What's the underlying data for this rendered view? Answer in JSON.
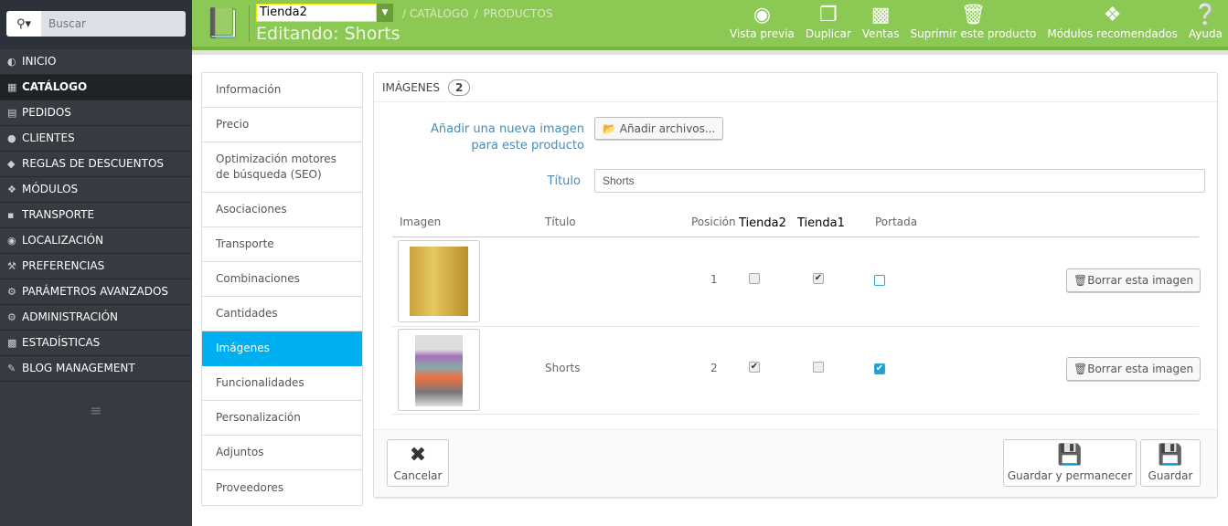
{
  "search": {
    "placeholder": "Buscar",
    "icon": "search-icon"
  },
  "sidebar": {
    "items": [
      {
        "label": "INICIO",
        "icon": "dashboard-icon"
      },
      {
        "label": "CATÁLOGO",
        "icon": "book-icon",
        "active": true
      },
      {
        "label": "PEDIDOS",
        "icon": "credit-card-icon"
      },
      {
        "label": "CLIENTES",
        "icon": "users-icon"
      },
      {
        "label": "REGLAS DE DESCUENTOS",
        "icon": "tags-icon"
      },
      {
        "label": "MÓDULOS",
        "icon": "puzzle-icon"
      },
      {
        "label": "TRANSPORTE",
        "icon": "truck-icon"
      },
      {
        "label": "LOCALIZACIÓN",
        "icon": "globe-icon"
      },
      {
        "label": "PREFERENCIAS",
        "icon": "wrench-icon"
      },
      {
        "label": "PARÁMETROS AVANZADOS",
        "icon": "cogs-icon"
      },
      {
        "label": "ADMINISTRACIÓN",
        "icon": "cog-icon"
      },
      {
        "label": "ESTADÍSTICAS",
        "icon": "bar-chart-icon"
      },
      {
        "label": "BLOG MANAGEMENT",
        "icon": "pencil-icon"
      }
    ]
  },
  "header": {
    "shop": "Tienda2",
    "breadcrumb": [
      "CATÁLOGO",
      "PRODUCTOS"
    ],
    "title": "Editando: Shorts",
    "color": "#8bc954",
    "tools": [
      {
        "label": "Vista previa",
        "icon": "eye-icon"
      },
      {
        "label": "Duplicar",
        "icon": "copy-icon"
      },
      {
        "label": "Ventas",
        "icon": "bar-chart-icon"
      },
      {
        "label": "Suprimir este producto",
        "icon": "trash-icon"
      },
      {
        "label": "Módulos recomendados",
        "icon": "puzzle-icon"
      },
      {
        "label": "Ayuda",
        "icon": "help-icon"
      }
    ]
  },
  "tabs": [
    "Información",
    "Precio",
    "Optimización motores de búsqueda (SEO)",
    "Asociaciones",
    "Transporte",
    "Combinaciones",
    "Cantidades",
    "Imágenes",
    "Funcionalidades",
    "Personalización",
    "Adjuntos",
    "Proveedores"
  ],
  "panel": {
    "title": "IMÁGENES",
    "count": "2",
    "add_label": "Añadir una nueva imagen para este producto",
    "add_button": "Añadir archivos...",
    "title_label": "Título",
    "title_value": "Shorts",
    "columns": [
      "Imagen",
      "Título",
      "Posición",
      "Tienda2",
      "Tienda1",
      "Portada"
    ],
    "rows": [
      {
        "title": "",
        "position": "1",
        "tienda2": false,
        "tienda1": true,
        "cover": false,
        "delete": "Borrar esta imagen"
      },
      {
        "title": "Shorts",
        "position": "2",
        "tienda2": true,
        "tienda1": false,
        "cover": true,
        "delete": "Borrar esta imagen"
      }
    ],
    "cancel": "Cancelar",
    "save_stay": "Guardar y permanecer",
    "save": "Guardar"
  }
}
